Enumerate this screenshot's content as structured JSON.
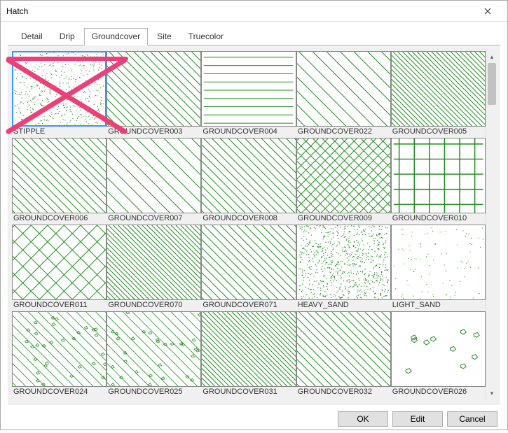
{
  "window": {
    "title": "Hatch"
  },
  "tabs": [
    {
      "label": "Detail",
      "active": false
    },
    {
      "label": "Drip",
      "active": false
    },
    {
      "label": "Groundcover",
      "active": true
    },
    {
      "label": "Site",
      "active": false
    },
    {
      "label": "Truecolor",
      "active": false
    }
  ],
  "patterns": [
    {
      "name": "STIPPLE",
      "kind": "stipple",
      "selected": true
    },
    {
      "name": "GROUNDCOVER003",
      "kind": "diag45",
      "selected": false
    },
    {
      "name": "GROUNDCOVER004",
      "kind": "horiz",
      "selected": false
    },
    {
      "name": "GROUNDCOVER022",
      "kind": "diag45w",
      "selected": false
    },
    {
      "name": "GROUNDCOVER005",
      "kind": "diag45d",
      "selected": false
    },
    {
      "name": "GROUNDCOVER006",
      "kind": "diag45",
      "selected": false
    },
    {
      "name": "GROUNDCOVER007",
      "kind": "diag45w",
      "selected": false
    },
    {
      "name": "GROUNDCOVER008",
      "kind": "diag45",
      "selected": false
    },
    {
      "name": "GROUNDCOVER009",
      "kind": "crosshatch",
      "selected": false
    },
    {
      "name": "GROUNDCOVER010",
      "kind": "squaregrid",
      "selected": false
    },
    {
      "name": "GROUNDCOVER011",
      "kind": "crosshatchw",
      "selected": false
    },
    {
      "name": "GROUNDCOVER070",
      "kind": "diag45d",
      "selected": false
    },
    {
      "name": "GROUNDCOVER071",
      "kind": "diag45",
      "selected": false
    },
    {
      "name": "HEAVY_SAND",
      "kind": "heavysand",
      "selected": false
    },
    {
      "name": "LIGHT_SAND",
      "kind": "lightsand",
      "selected": false
    },
    {
      "name": "GROUNDCOVER024",
      "kind": "scribble",
      "selected": false
    },
    {
      "name": "GROUNDCOVER025",
      "kind": "scribble",
      "selected": false
    },
    {
      "name": "GROUNDCOVER031",
      "kind": "diag45d",
      "selected": false
    },
    {
      "name": "GROUNDCOVER032",
      "kind": "diag45",
      "selected": false
    },
    {
      "name": "GROUNDCOVER026",
      "kind": "sparse",
      "selected": false
    }
  ],
  "buttons": {
    "ok": "OK",
    "edit": "Edit",
    "cancel": "Cancel"
  },
  "colors": {
    "line": "#1a8f1a",
    "annot": "#ec4079"
  }
}
